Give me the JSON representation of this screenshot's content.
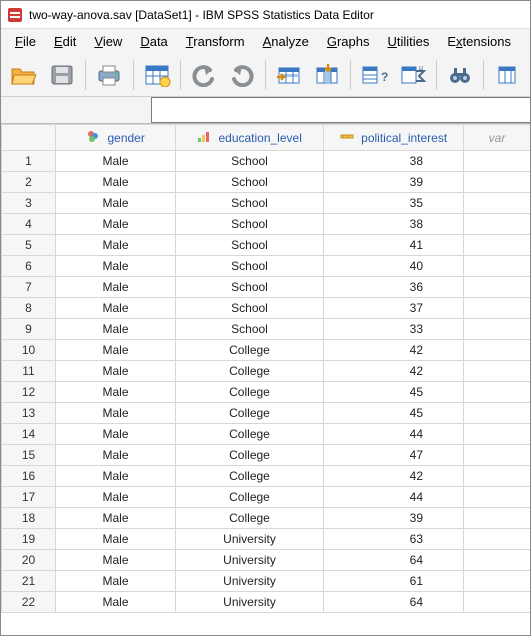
{
  "window": {
    "filename": "two-way-anova.sav",
    "dataset": "[DataSet1]",
    "app": "IBM SPSS Statistics Data Editor"
  },
  "menu": {
    "file": "File",
    "edit": "Edit",
    "view": "View",
    "data": "Data",
    "transform": "Transform",
    "analyze": "Analyze",
    "graphs": "Graphs",
    "utilities": "Utilities",
    "extensions": "Extensions"
  },
  "columns": {
    "gender": "gender",
    "education_level": "education_level",
    "political_interest": "political_interest",
    "var": "var"
  },
  "rows": [
    {
      "n": "1",
      "gender": "Male",
      "edu": "School",
      "pol": "38"
    },
    {
      "n": "2",
      "gender": "Male",
      "edu": "School",
      "pol": "39"
    },
    {
      "n": "3",
      "gender": "Male",
      "edu": "School",
      "pol": "35"
    },
    {
      "n": "4",
      "gender": "Male",
      "edu": "School",
      "pol": "38"
    },
    {
      "n": "5",
      "gender": "Male",
      "edu": "School",
      "pol": "41"
    },
    {
      "n": "6",
      "gender": "Male",
      "edu": "School",
      "pol": "40"
    },
    {
      "n": "7",
      "gender": "Male",
      "edu": "School",
      "pol": "36"
    },
    {
      "n": "8",
      "gender": "Male",
      "edu": "School",
      "pol": "37"
    },
    {
      "n": "9",
      "gender": "Male",
      "edu": "School",
      "pol": "33"
    },
    {
      "n": "10",
      "gender": "Male",
      "edu": "College",
      "pol": "42"
    },
    {
      "n": "11",
      "gender": "Male",
      "edu": "College",
      "pol": "42"
    },
    {
      "n": "12",
      "gender": "Male",
      "edu": "College",
      "pol": "45"
    },
    {
      "n": "13",
      "gender": "Male",
      "edu": "College",
      "pol": "45"
    },
    {
      "n": "14",
      "gender": "Male",
      "edu": "College",
      "pol": "44"
    },
    {
      "n": "15",
      "gender": "Male",
      "edu": "College",
      "pol": "47"
    },
    {
      "n": "16",
      "gender": "Male",
      "edu": "College",
      "pol": "42"
    },
    {
      "n": "17",
      "gender": "Male",
      "edu": "College",
      "pol": "44"
    },
    {
      "n": "18",
      "gender": "Male",
      "edu": "College",
      "pol": "39"
    },
    {
      "n": "19",
      "gender": "Male",
      "edu": "University",
      "pol": "63"
    },
    {
      "n": "20",
      "gender": "Male",
      "edu": "University",
      "pol": "64"
    },
    {
      "n": "21",
      "gender": "Male",
      "edu": "University",
      "pol": "61"
    },
    {
      "n": "22",
      "gender": "Male",
      "edu": "University",
      "pol": "64"
    }
  ]
}
